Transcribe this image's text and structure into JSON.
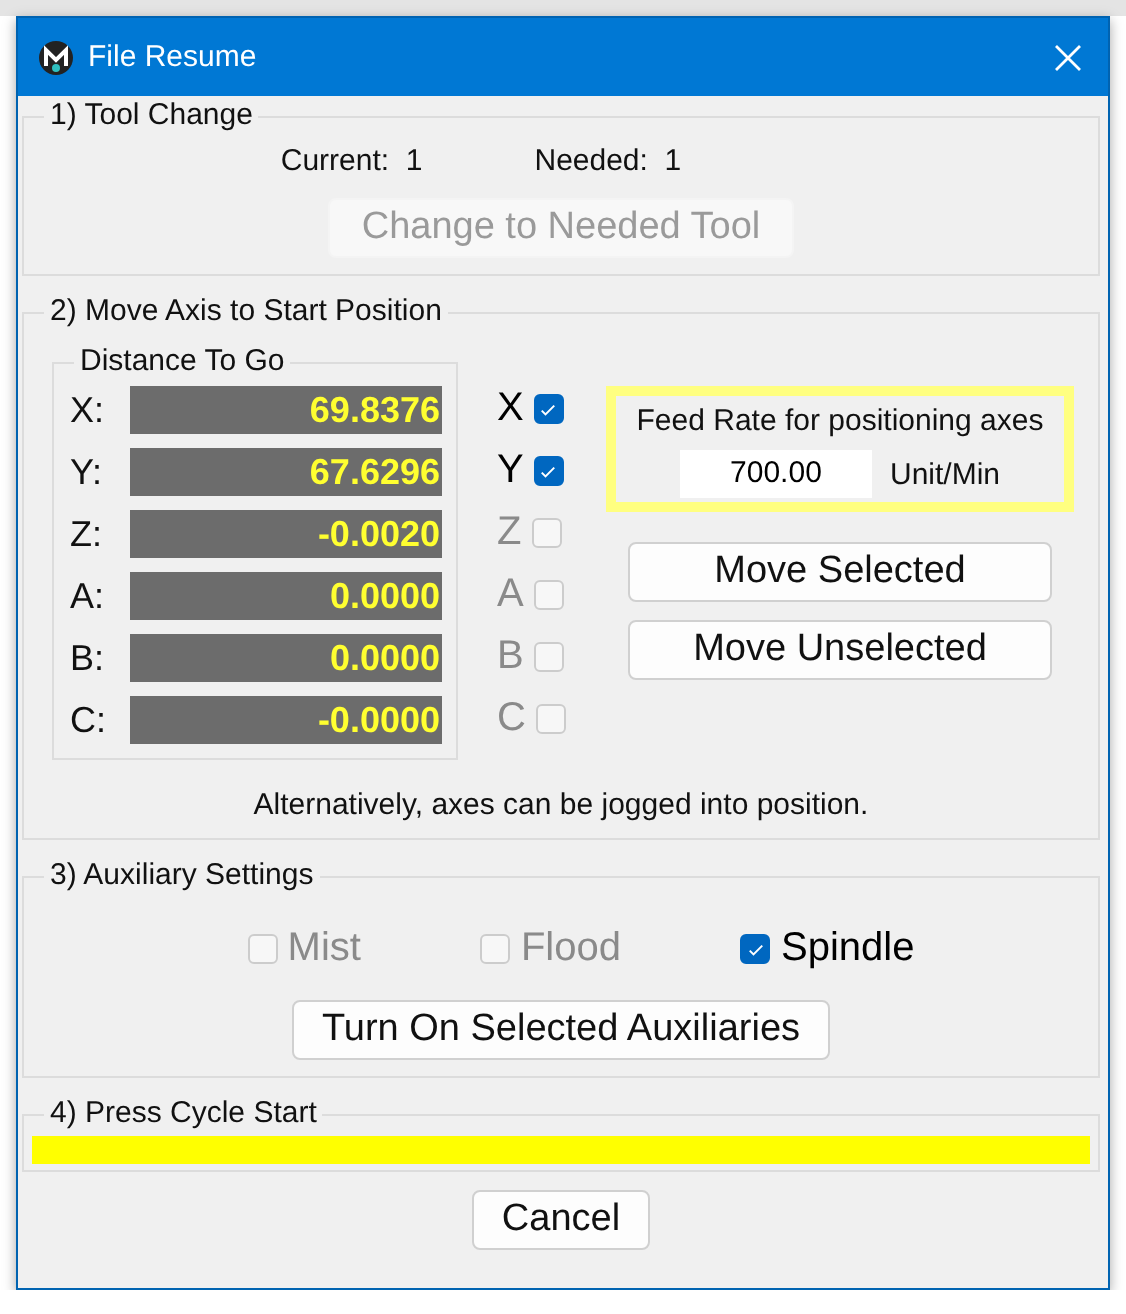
{
  "window": {
    "title": "File Resume"
  },
  "tool_change": {
    "title": "1) Tool Change",
    "current_label": "Current:",
    "current": "1",
    "needed_label": "Needed:",
    "needed": "1",
    "button": {
      "label": "Change to Needed Tool",
      "disabled": true
    }
  },
  "move_axis": {
    "title": "2) Move Axis to Start Position",
    "distance_title": "Distance To Go",
    "axes": [
      {
        "label": "X:",
        "value": "69.8376",
        "check_label": "X",
        "checked": true,
        "disabled": false
      },
      {
        "label": "Y:",
        "value": "67.6296",
        "check_label": "Y",
        "checked": true,
        "disabled": false
      },
      {
        "label": "Z:",
        "value": "-0.0020",
        "check_label": "Z",
        "checked": false,
        "disabled": true
      },
      {
        "label": "A:",
        "value": "0.0000",
        "check_label": "A",
        "checked": false,
        "disabled": true
      },
      {
        "label": "B:",
        "value": "0.0000",
        "check_label": "B",
        "checked": false,
        "disabled": true
      },
      {
        "label": "C:",
        "value": "-0.0000",
        "check_label": "C",
        "checked": false,
        "disabled": true
      }
    ],
    "feed_rate": {
      "label": "Feed Rate for positioning axes",
      "value": "700.00",
      "unit": "Unit/Min"
    },
    "buttons": [
      "Move Selected",
      "Move Unselected"
    ],
    "note": "Alternatively, axes can be jogged into position."
  },
  "auxiliary": {
    "title": "3) Auxiliary Settings",
    "options": [
      {
        "label": "Mist",
        "checked": false,
        "disabled": true
      },
      {
        "label": "Flood",
        "checked": false,
        "disabled": true
      },
      {
        "label": "Spindle",
        "checked": true,
        "disabled": false
      }
    ],
    "button": "Turn On Selected Auxiliaries"
  },
  "cycle_start": {
    "title": "4) Press Cycle Start"
  },
  "cancel": "Cancel"
}
